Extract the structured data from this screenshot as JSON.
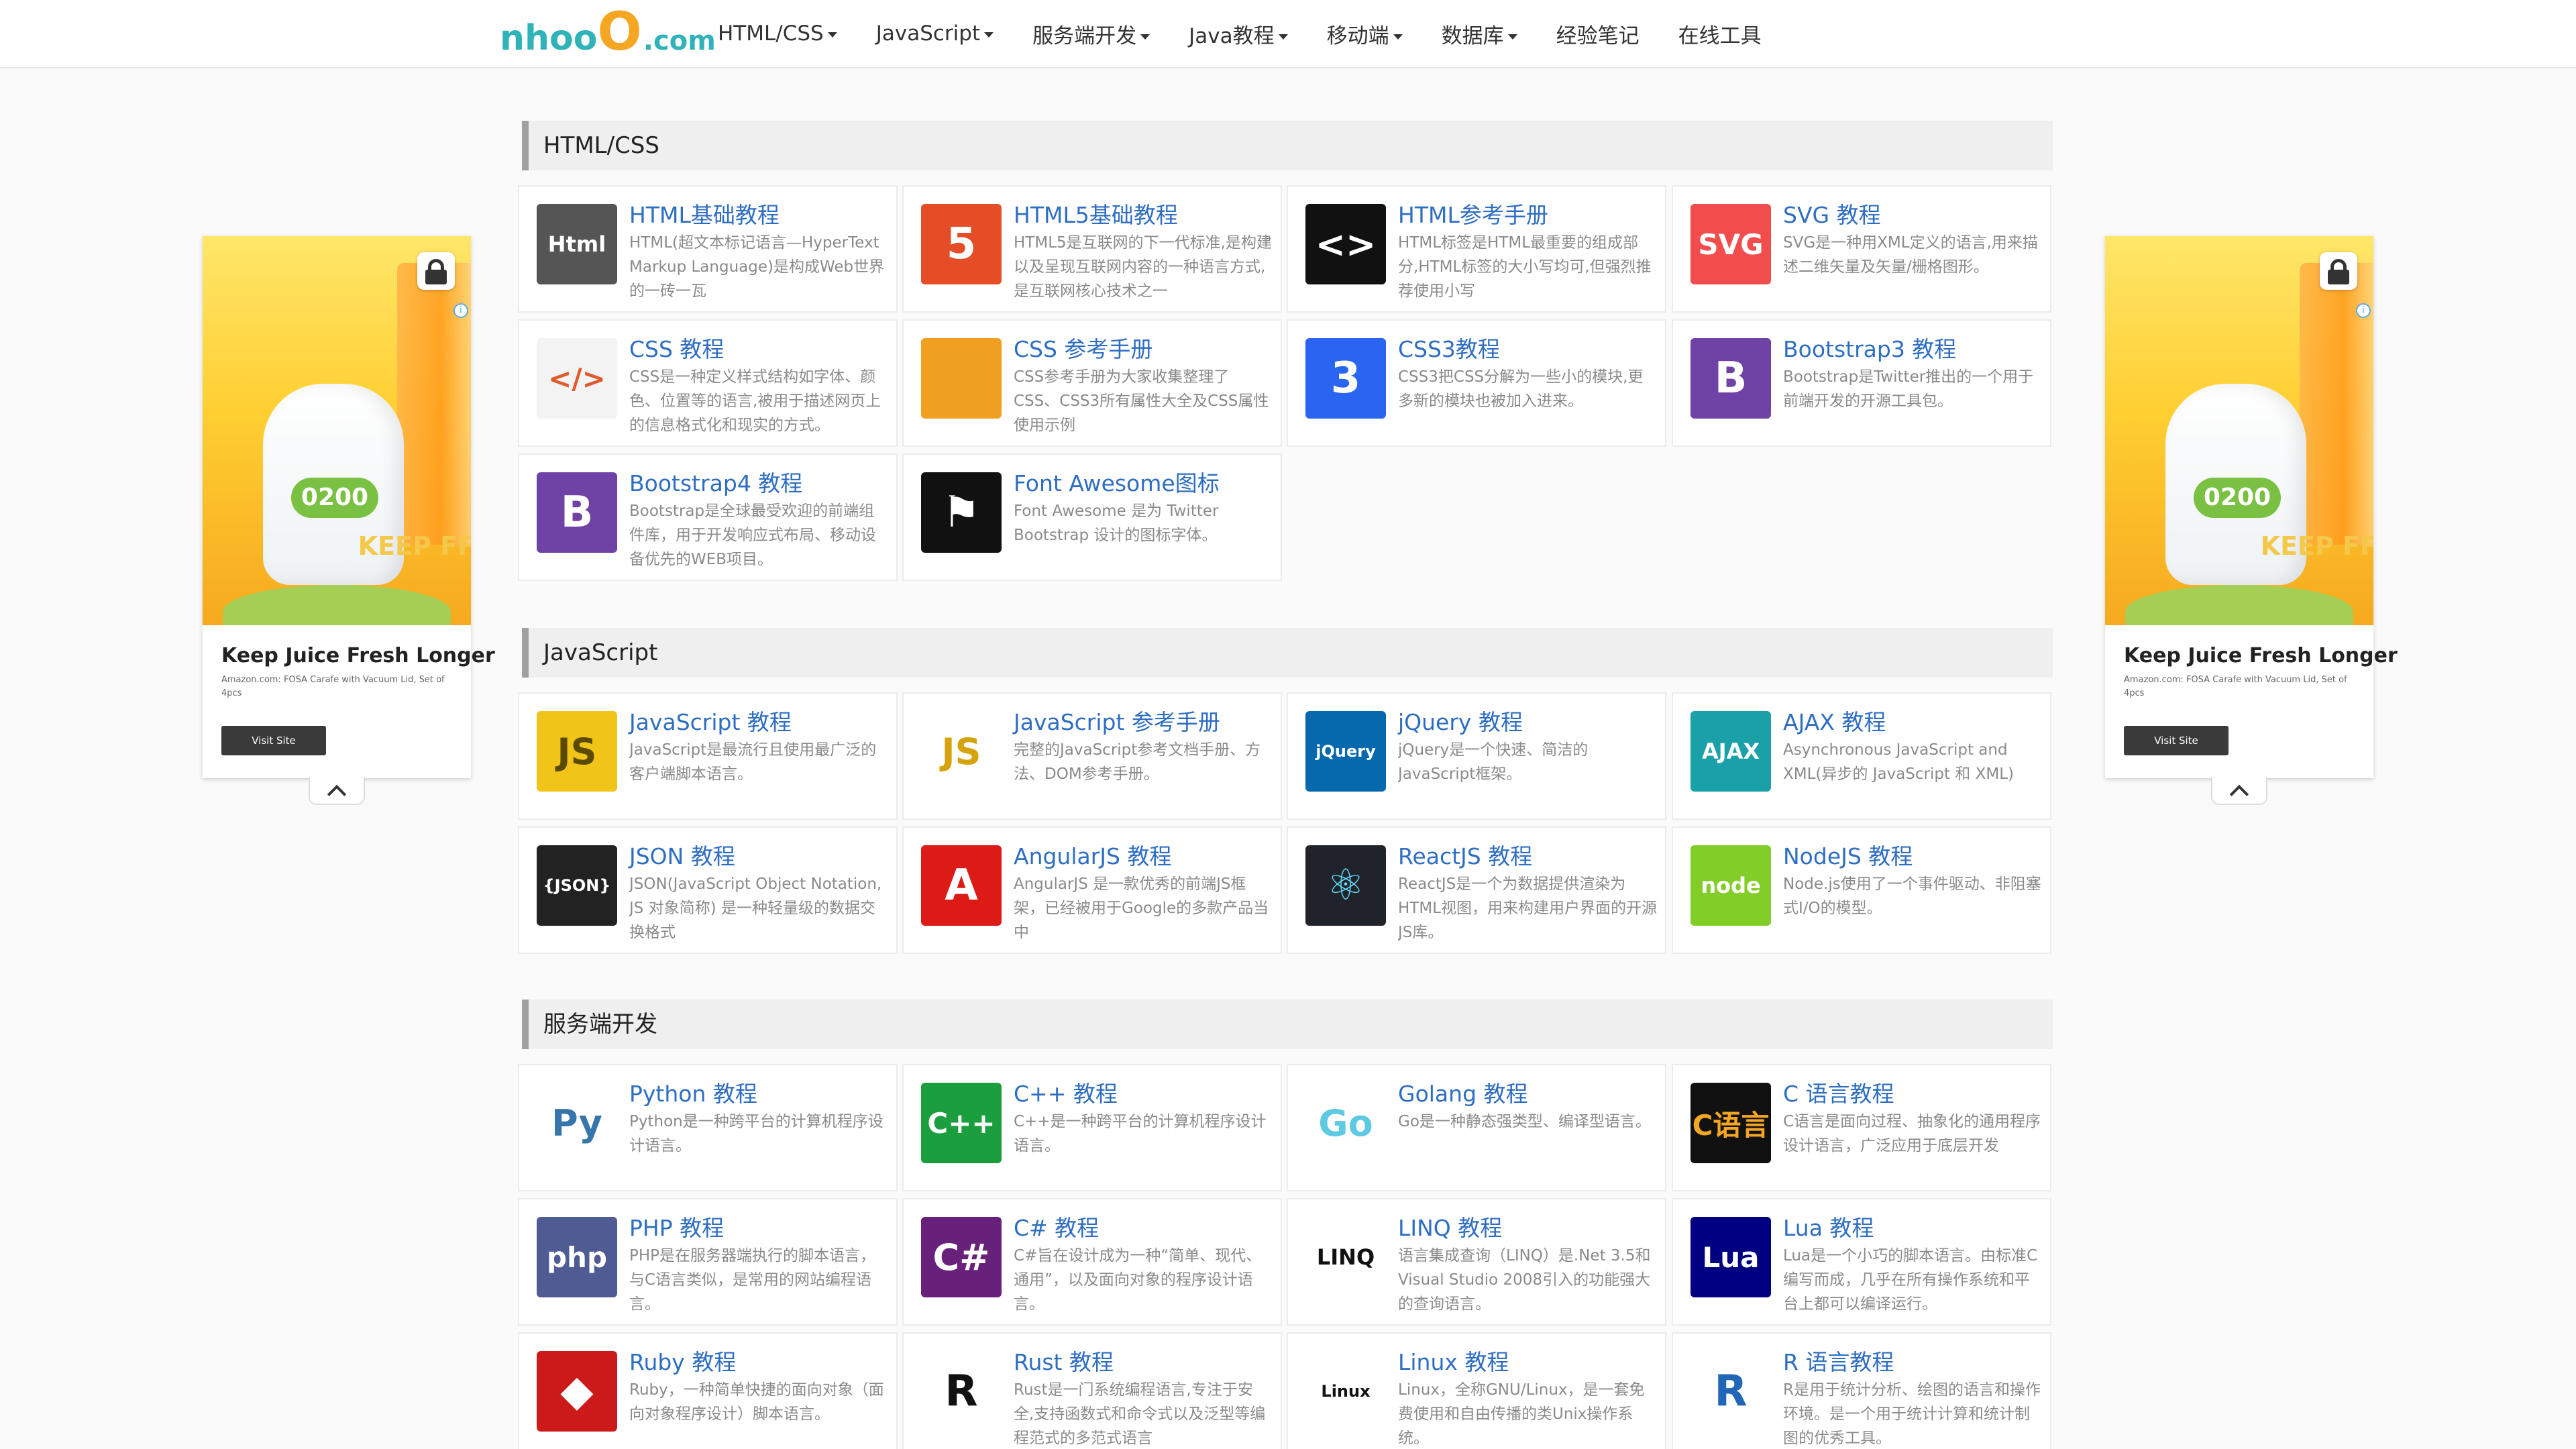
{
  "header": {
    "logo": {
      "part1": "nho",
      "part2": "o",
      "part3": "O",
      "part4": ".com"
    },
    "nav": [
      {
        "label": "HTML/CSS",
        "dropdown": true
      },
      {
        "label": "JavaScript",
        "dropdown": true
      },
      {
        "label": "服务端开发",
        "dropdown": true
      },
      {
        "label": "Java教程",
        "dropdown": true
      },
      {
        "label": "移动端",
        "dropdown": true
      },
      {
        "label": "数据库",
        "dropdown": true
      },
      {
        "label": "经验笔记",
        "dropdown": false
      },
      {
        "label": "在线工具",
        "dropdown": false
      }
    ]
  },
  "ads": {
    "brand": "0200",
    "keep_text": "KEEP FF",
    "title": "Keep Juice Fresh Longer",
    "subtitle": "Amazon.com: FOSA Carafe with Vacuum Lid, Set of 4pcs",
    "button": "Visit Site",
    "info": "i"
  },
  "sections": [
    {
      "title": "HTML/CSS",
      "items": [
        {
          "title": "HTML基础教程",
          "desc": "HTML(超文本标记语言—HyperText Markup Language)是构成Web世界的一砖一瓦",
          "icon": "html-icon",
          "icon_text": "Html",
          "bg": "#555555",
          "fg": "#ffffff"
        },
        {
          "title": "HTML5基础教程",
          "desc": "HTML5是互联网的下一代标准,是构建以及呈现互联网内容的一种语言方式,是互联网核心技术之一",
          "icon": "html5-shield-icon",
          "icon_text": "5",
          "bg": "#e44d26",
          "fg": "#ffffff"
        },
        {
          "title": "HTML参考手册",
          "desc": "HTML标签是HTML最重要的组成部分,HTML标签的大小写均可,但强烈推荐使用小写",
          "icon": "html-code-icon",
          "icon_text": "<>",
          "bg": "#111111",
          "fg": "#ffffff"
        },
        {
          "title": "SVG 教程",
          "desc": "SVG是一种用XML定义的语言,用来描述二维矢量及矢量/栅格图形。",
          "icon": "svg-icon",
          "icon_text": "SVG",
          "bg": "#f24d4d",
          "fg": "#ffffff"
        },
        {
          "title": "CSS 教程",
          "desc": "CSS是一种定义样式结构如字体、颜色、位置等的语言,被用于描述网页上的信息格式化和现实的方式。",
          "icon": "css-code-icon",
          "icon_text": "</>",
          "bg": "#f3f3f3",
          "fg": "#e05a2b"
        },
        {
          "title": "CSS 参考手册",
          "desc": "CSS参考手册为大家收集整理了CSS、CSS3所有属性大全及CSS属性使用示例",
          "icon": "css-book-icon",
          "icon_text": "",
          "bg": "#f0a020",
          "fg": "#e03b2b"
        },
        {
          "title": "CSS3教程",
          "desc": "CSS3把CSS分解为一些小的模块,更多新的模块也被加入进来。",
          "icon": "css3-shield-icon",
          "icon_text": "3",
          "bg": "#2965f1",
          "fg": "#ffffff"
        },
        {
          "title": "Bootstrap3 教程",
          "desc": "Bootstrap是Twitter推出的一个用于前端开发的开源工具包。",
          "icon": "bootstrap-icon",
          "icon_text": "B",
          "bg": "#6f42a6",
          "fg": "#ffffff"
        },
        {
          "title": "Bootstrap4 教程",
          "desc": "Bootstrap是全球最受欢迎的前端组件库，用于开发响应式布局、移动设备优先的WEB项目。",
          "icon": "bootstrap-icon",
          "icon_text": "B",
          "bg": "#6f42a6",
          "fg": "#ffffff"
        },
        {
          "title": "Font Awesome图标",
          "desc": "Font Awesome 是为 Twitter Bootstrap 设计的图标字体。",
          "icon": "flag-icon",
          "icon_text": "⚑",
          "bg": "#111111",
          "fg": "#ffffff"
        }
      ]
    },
    {
      "title": "JavaScript",
      "items": [
        {
          "title": "JavaScript 教程",
          "desc": "JavaScript是最流行且使用最广泛的客户端脚本语言。",
          "icon": "javascript-shield-icon",
          "icon_text": "JS",
          "bg": "#f0c419",
          "fg": "#5a4b00"
        },
        {
          "title": "JavaScript 参考手册",
          "desc": "完整的JavaScript参考文档手册、方法、DOM参考手册。",
          "icon": "javascript-book-icon",
          "icon_text": "JS",
          "bg": "#ffffff",
          "fg": "#d6a30c"
        },
        {
          "title": "jQuery 教程",
          "desc": "jQuery是一个快速、简洁的JavaScript框架。",
          "icon": "jquery-icon",
          "icon_text": "jQuery",
          "bg": "#0769ad",
          "fg": "#ffffff"
        },
        {
          "title": "AJAX 教程",
          "desc": "Asynchronous JavaScript and XML(异步的 JavaScript 和 XML)",
          "icon": "ajax-icon",
          "icon_text": "AJAX",
          "bg": "#1aa0a8",
          "fg": "#ffffff"
        },
        {
          "title": "JSON 教程",
          "desc": "JSON(JavaScript Object Notation, JS 对象简称) 是一种轻量级的数据交换格式",
          "icon": "json-icon",
          "icon_text": "{JSON}",
          "bg": "#222222",
          "fg": "#ffffff"
        },
        {
          "title": "AngularJS 教程",
          "desc": "AngularJS 是一款优秀的前端JS框架，已经被用于Google的多款产品当中",
          "icon": "angular-icon",
          "icon_text": "A",
          "bg": "#dd1b16",
          "fg": "#ffffff"
        },
        {
          "title": "ReactJS 教程",
          "desc": "ReactJS是一个为数据提供渲染为HTML视图，用来构建用户界面的开源JS库。",
          "icon": "react-atom-icon",
          "icon_text": "⚛",
          "bg": "#20232a",
          "fg": "#61dafb"
        },
        {
          "title": "NodeJS 教程",
          "desc": "Node.js使用了一个事件驱动、非阻塞式I/O的模型。",
          "icon": "nodejs-icon",
          "icon_text": "node",
          "bg": "#83cd29",
          "fg": "#ffffff"
        }
      ]
    },
    {
      "title": "服务端开发",
      "items": [
        {
          "title": "Python 教程",
          "desc": "Python是一种跨平台的计算机程序设计语言。",
          "icon": "python-icon",
          "icon_text": "Py",
          "bg": "#ffffff",
          "fg": "#3776ab"
        },
        {
          "title": "C++ 教程",
          "desc": "C++是一种跨平台的计算机程序设计语言。",
          "icon": "cpp-icon",
          "icon_text": "C++",
          "bg": "#1b9e3e",
          "fg": "#ffffff"
        },
        {
          "title": "Golang 教程",
          "desc": "Go是一种静态强类型、编译型语言。",
          "icon": "gopher-icon",
          "icon_text": "Go",
          "bg": "#ffffff",
          "fg": "#5dc9e2"
        },
        {
          "title": "C 语言教程",
          "desc": "C语言是面向过程、抽象化的通用程序设计语言，广泛应用于底层开发",
          "icon": "c-language-icon",
          "icon_text": "C语言",
          "bg": "#111111",
          "fg": "#f5a623"
        },
        {
          "title": "PHP 教程",
          "desc": "PHP是在服务器端执行的脚本语言，与C语言类似，是常用的网站编程语言。",
          "icon": "php-icon",
          "icon_text": "php",
          "bg": "#4f5b93",
          "fg": "#ffffff"
        },
        {
          "title": "C# 教程",
          "desc": "C#旨在设计成为一种“简单、现代、通用”，以及面向对象的程序设计语言。",
          "icon": "csharp-icon",
          "icon_text": "C#",
          "bg": "#68217a",
          "fg": "#ffffff"
        },
        {
          "title": "LINQ 教程",
          "desc": "语言集成查询（LINQ）是.Net 3.5和Visual Studio 2008引入的功能强大的查询语言。",
          "icon": "linq-icon",
          "icon_text": "LINQ",
          "bg": "#ffffff",
          "fg": "#111111"
        },
        {
          "title": "Lua 教程",
          "desc": "Lua是一个小巧的脚本语言。由标准C编写而成，几乎在所有操作系统和平台上都可以编译运行。",
          "icon": "lua-icon",
          "icon_text": "Lua",
          "bg": "#000080",
          "fg": "#ffffff"
        },
        {
          "title": "Ruby 教程",
          "desc": "Ruby，一种简单快捷的面向对象（面向对象程序设计）脚本语言。",
          "icon": "ruby-gem-icon",
          "icon_text": "◆",
          "bg": "#cc1a1a",
          "fg": "#ffffff"
        },
        {
          "title": "Rust 教程",
          "desc": "Rust是一门系统编程语言,专注于安全,支持函数式和命令式以及泛型等编程范式的多范式语言",
          "icon": "rust-gear-icon",
          "icon_text": "R",
          "bg": "#ffffff",
          "fg": "#111111"
        },
        {
          "title": "Linux 教程",
          "desc": "Linux，全称GNU/Linux，是一套免费使用和自由传播的类Unix操作系统。",
          "icon": "linux-tux-icon",
          "icon_text": "Linux",
          "bg": "#ffffff",
          "fg": "#111111"
        },
        {
          "title": "R 语言教程",
          "desc": "R是用于统计分析、绘图的语言和操作环境。是一个用于统计计算和统计制图的优秀工具。",
          "icon": "r-language-icon",
          "icon_text": "R",
          "bg": "#ffffff",
          "fg": "#2266b8"
        }
      ]
    }
  ]
}
